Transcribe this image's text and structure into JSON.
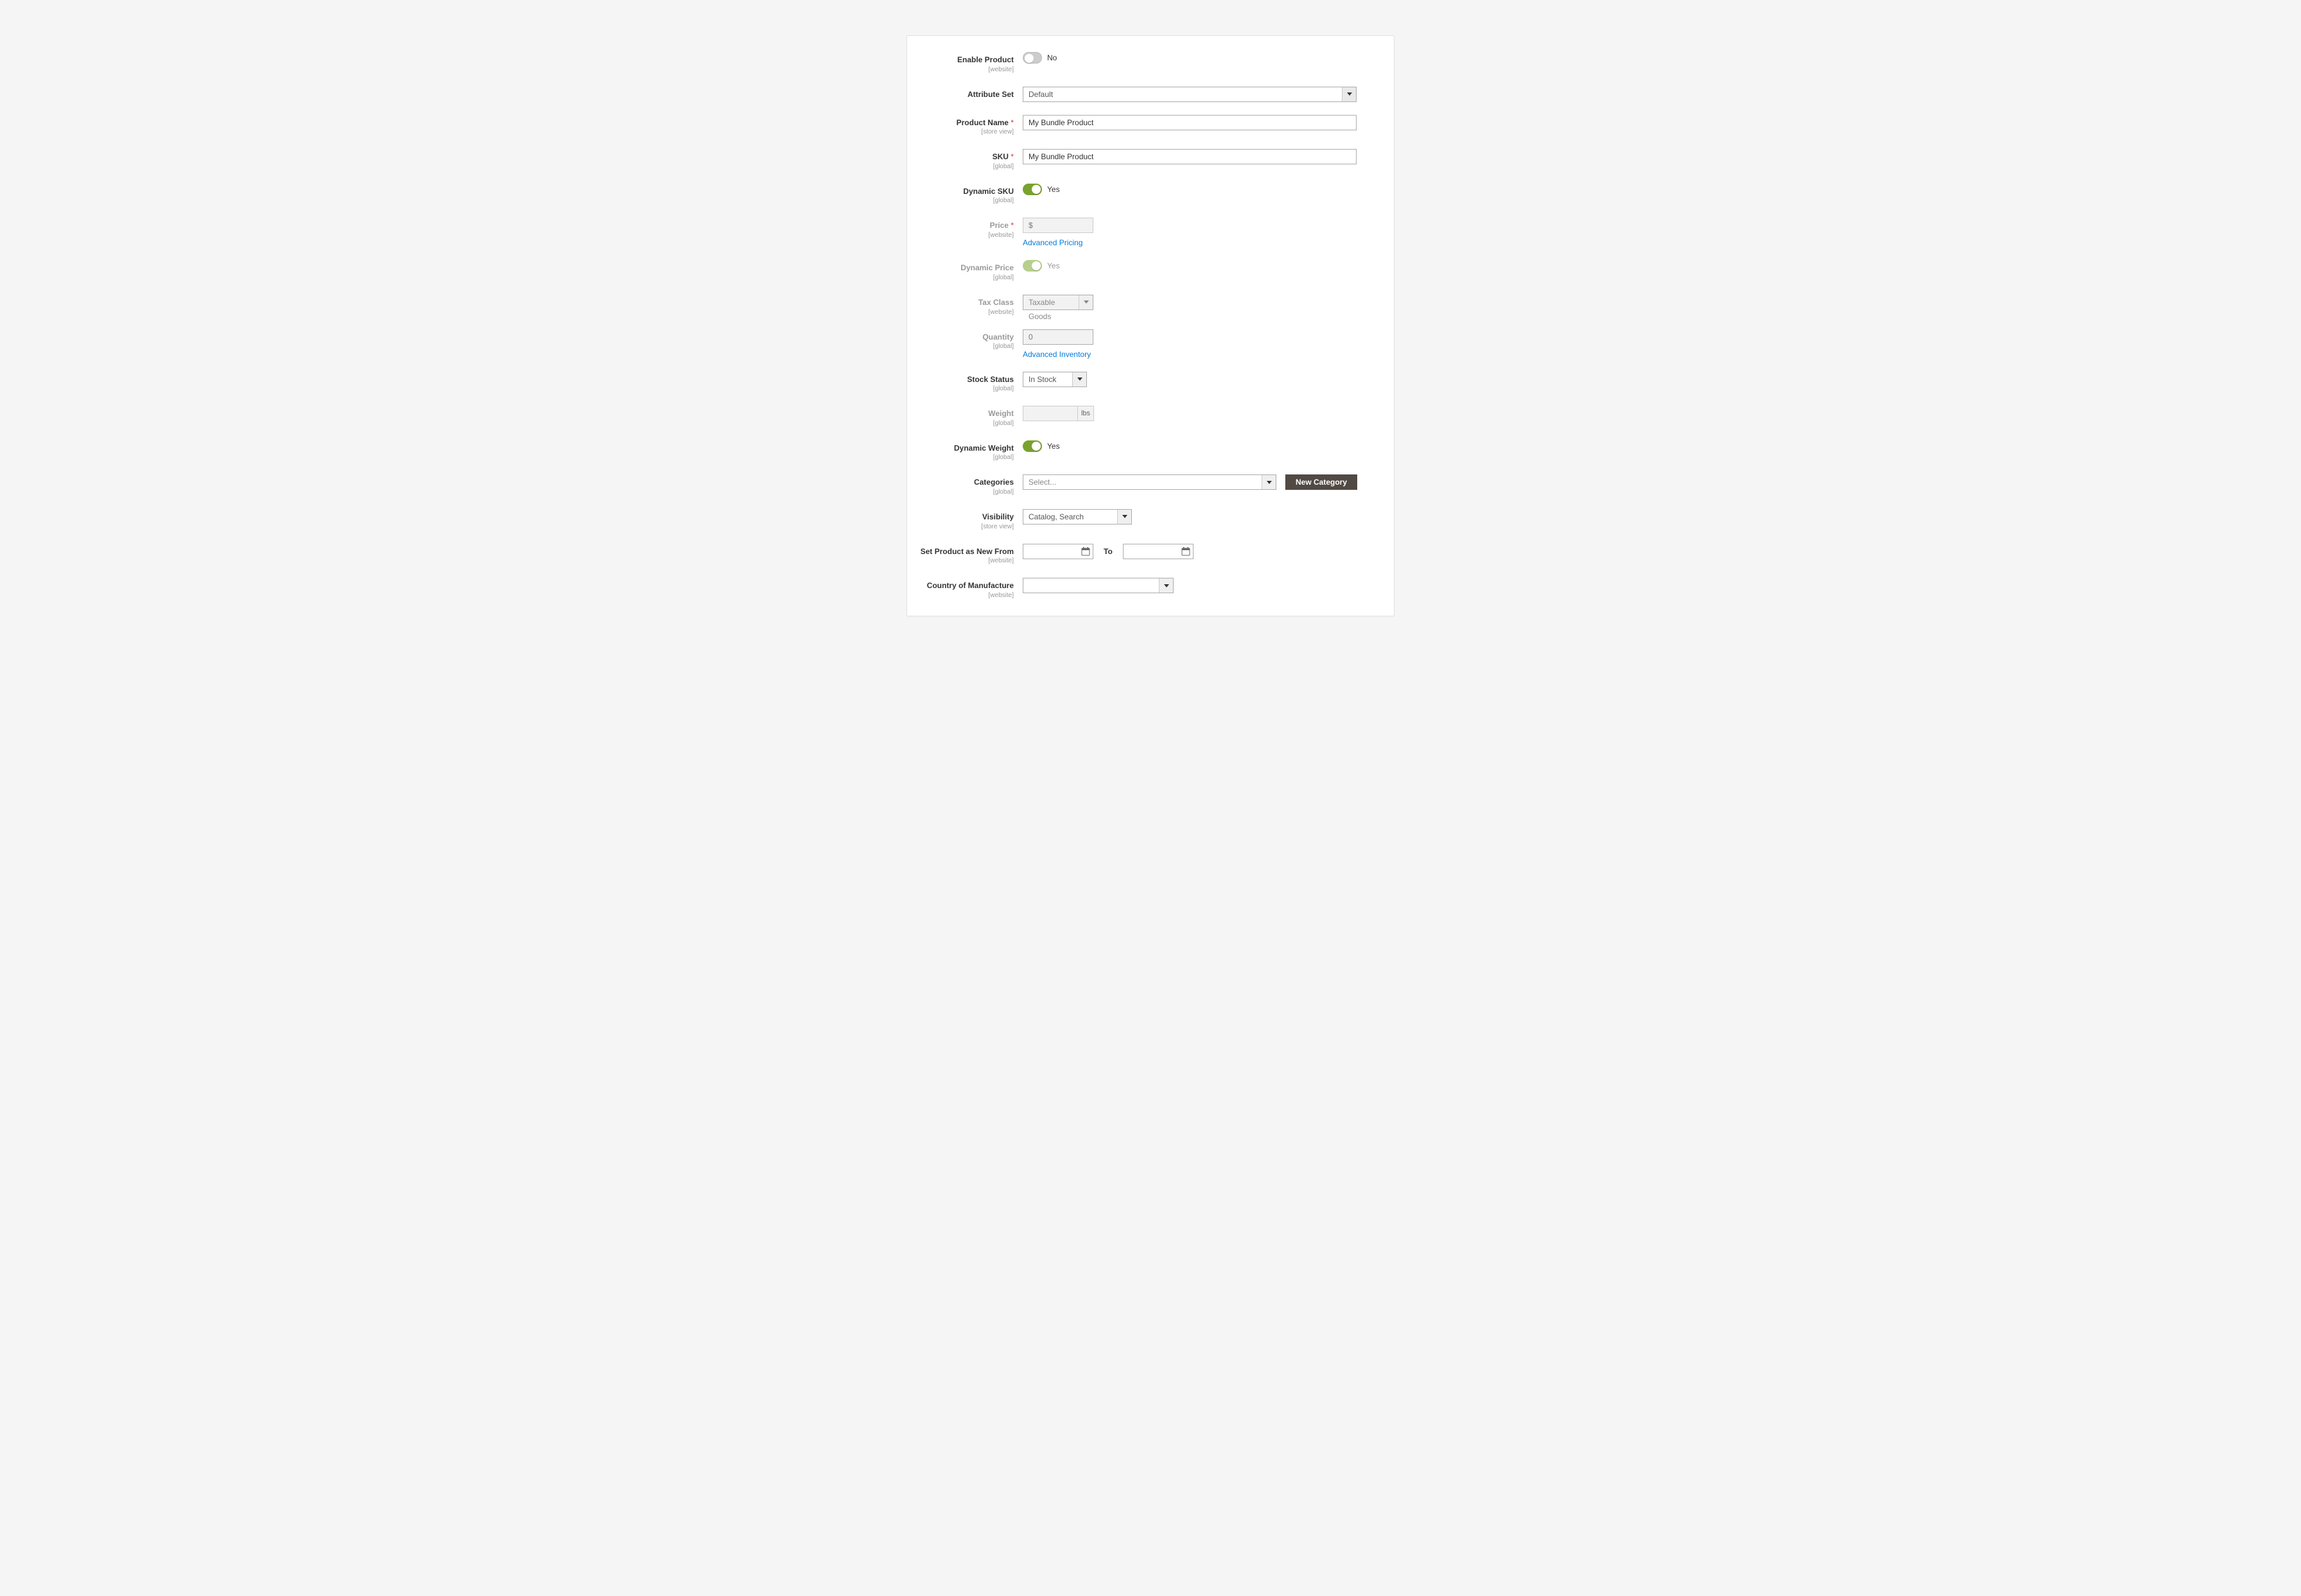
{
  "fields": {
    "enable_product": {
      "label": "Enable Product",
      "scope": "[website]",
      "value_text": "No"
    },
    "attribute_set": {
      "label": "Attribute Set",
      "value": "Default"
    },
    "product_name": {
      "label": "Product Name",
      "scope": "[store view]",
      "value": "My Bundle Product"
    },
    "sku": {
      "label": "SKU",
      "scope": "[global]",
      "value": "My Bundle Product"
    },
    "dynamic_sku": {
      "label": "Dynamic SKU",
      "scope": "[global]",
      "value_text": "Yes"
    },
    "price": {
      "label": "Price",
      "scope": "[website]",
      "currency": "$",
      "advanced_link": "Advanced Pricing"
    },
    "dynamic_price": {
      "label": "Dynamic Price",
      "scope": "[global]",
      "value_text": "Yes"
    },
    "tax_class": {
      "label": "Tax Class",
      "scope": "[website]",
      "value": "Taxable Goods"
    },
    "quantity": {
      "label": "Quantity",
      "scope": "[global]",
      "value": "0",
      "advanced_link": "Advanced Inventory"
    },
    "stock_status": {
      "label": "Stock Status",
      "scope": "[global]",
      "value": "In Stock"
    },
    "weight": {
      "label": "Weight",
      "scope": "[global]",
      "unit": "lbs"
    },
    "dynamic_weight": {
      "label": "Dynamic Weight",
      "scope": "[global]",
      "value_text": "Yes"
    },
    "categories": {
      "label": "Categories",
      "scope": "[global]",
      "placeholder": "Select...",
      "new_button": "New Category"
    },
    "visibility": {
      "label": "Visibility",
      "scope": "[store view]",
      "value": "Catalog, Search"
    },
    "new_from": {
      "label": "Set Product as New From",
      "scope": "[website]",
      "to_label": "To"
    },
    "country": {
      "label": "Country of Manufacture",
      "scope": "[website]",
      "value": ""
    }
  }
}
